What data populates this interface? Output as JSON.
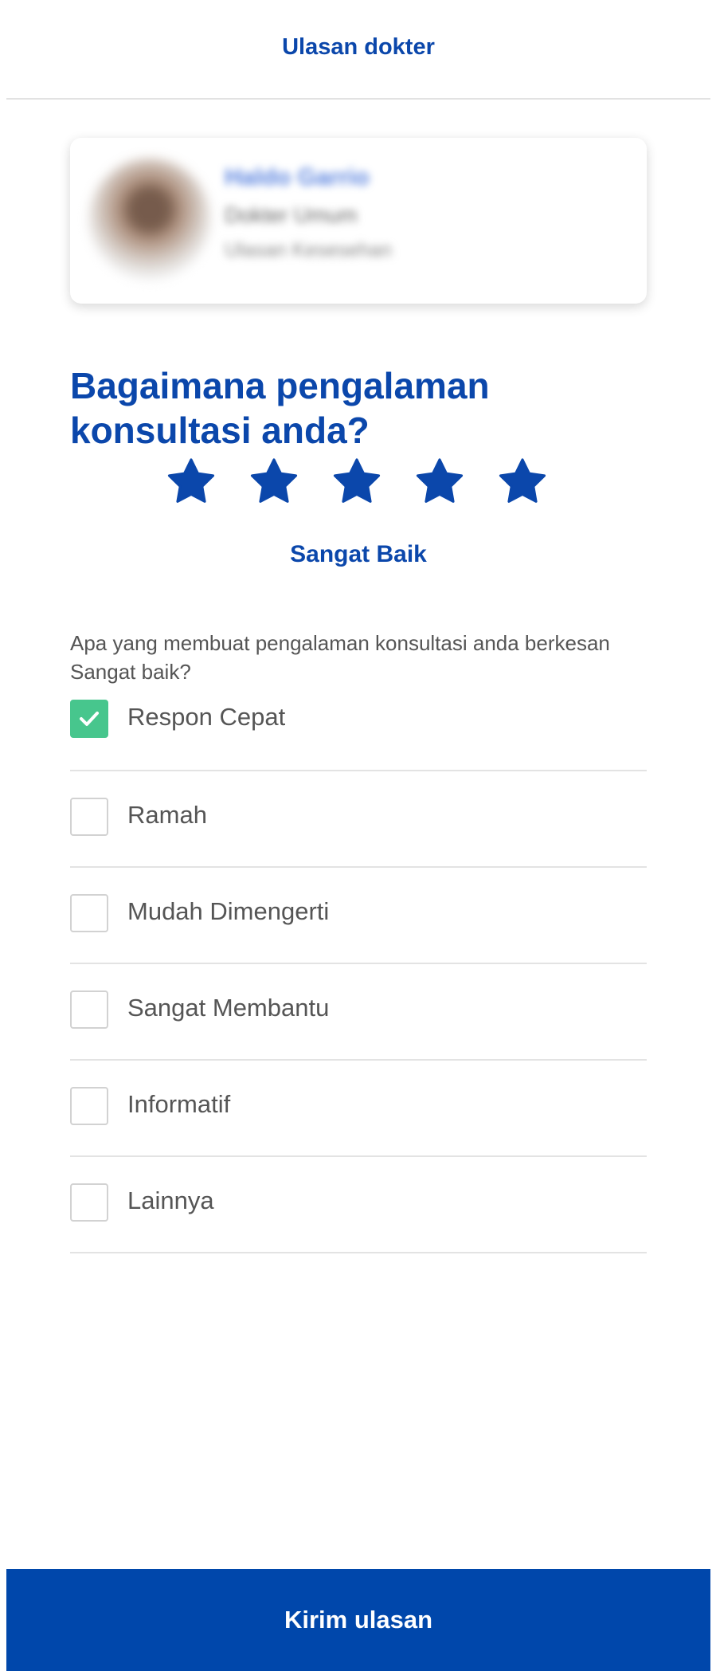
{
  "header": {
    "title": "Ulasan dokter"
  },
  "doctor_card": {
    "name": "Haldo Garrio",
    "role": "Dokter Umum",
    "specialty": "Ulasan Kesesehan"
  },
  "review": {
    "question": "Bagaimana pengalaman konsultasi anda?",
    "rating": 5,
    "rating_max": 5,
    "rating_label": "Sangat Baik",
    "prompt": "Apa yang membuat pengalaman konsultasi anda berkesan Sangat baik?"
  },
  "options": [
    {
      "label": "Respon Cepat",
      "checked": true
    },
    {
      "label": "Ramah",
      "checked": false
    },
    {
      "label": "Mudah Dimengerti",
      "checked": false
    },
    {
      "label": "Sangat Membantu",
      "checked": false
    },
    {
      "label": "Informatif",
      "checked": false
    },
    {
      "label": "Lainnya",
      "checked": false
    }
  ],
  "actions": {
    "submit_label": "Kirim ulasan"
  },
  "icons": {
    "star": "star-icon",
    "check": "check-icon"
  },
  "colors": {
    "primary": "#0047AB",
    "checked": "#47C68D",
    "text": "#555555",
    "divider": "#E3E3E3"
  }
}
